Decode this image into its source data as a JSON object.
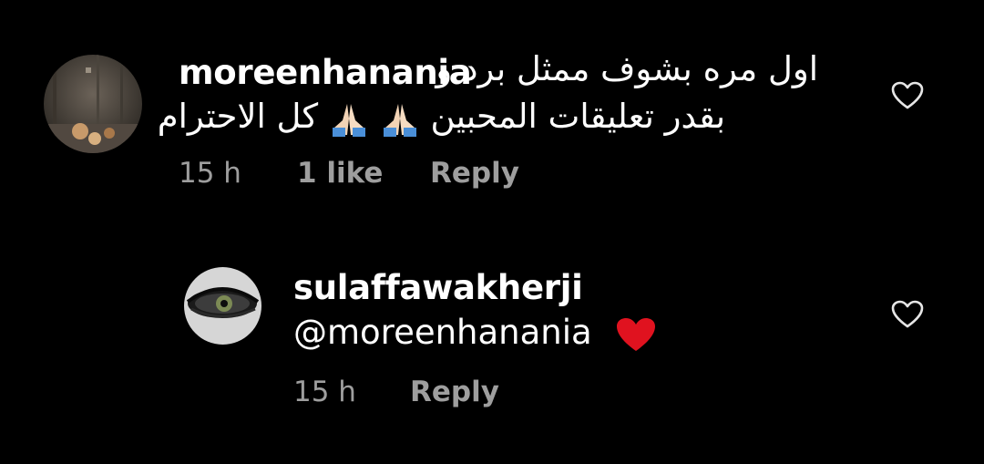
{
  "comments": [
    {
      "username": "moreenhanania",
      "text_line1": "اول مره بشوف ممثل برد و",
      "text_line2_start": "بقدر تعليقات المحبين",
      "text_line2_end": "كل الاحترام",
      "emoji": [
        "folded-hands-emoji",
        "folded-hands-emoji"
      ],
      "time": "15 h",
      "likes": "1 like",
      "reply_label": "Reply",
      "avatar": "avatar-photo"
    },
    {
      "username": "sulaffawakherji",
      "mention": "@moreenhanania",
      "emoji": "red-heart-emoji",
      "time": "15 h",
      "reply_label": "Reply",
      "avatar": "avatar-eye-photo"
    }
  ],
  "colors": {
    "background": "#000000",
    "primary_text": "#ffffff",
    "secondary_text": "#9e9e9e",
    "heart_red": "#e0121f"
  }
}
